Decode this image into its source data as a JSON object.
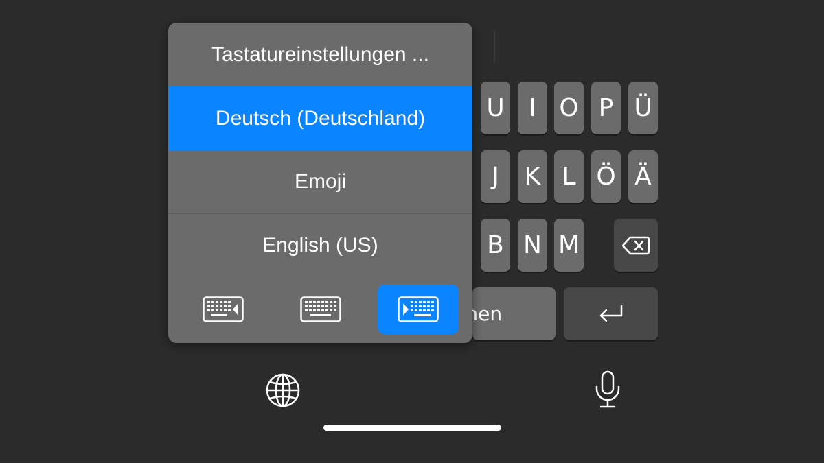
{
  "popup": {
    "items": [
      {
        "label": "Tastatureinstellungen ..."
      },
      {
        "label": "Deutsch (Deutschland)",
        "selected": true
      },
      {
        "label": "Emoji"
      },
      {
        "label": "English (US)"
      }
    ],
    "modes": [
      {
        "icon": "keyboard-left-icon",
        "active": false
      },
      {
        "icon": "keyboard-full-icon",
        "active": false
      },
      {
        "icon": "keyboard-right-icon",
        "active": true
      }
    ],
    "accent_color": "#0a84ff"
  },
  "keyboard": {
    "row1": [
      "U",
      "I",
      "O",
      "P",
      "Ü"
    ],
    "row2": [
      "J",
      "K",
      "L",
      "Ö",
      "Ä"
    ],
    "row3": [
      "B",
      "N",
      "M"
    ],
    "space_partial_label": "chen",
    "delete_icon": "delete-backward-icon",
    "return_icon": "return-icon"
  },
  "bottom_bar": {
    "globe_icon": "globe-icon",
    "mic_icon": "microphone-icon"
  }
}
